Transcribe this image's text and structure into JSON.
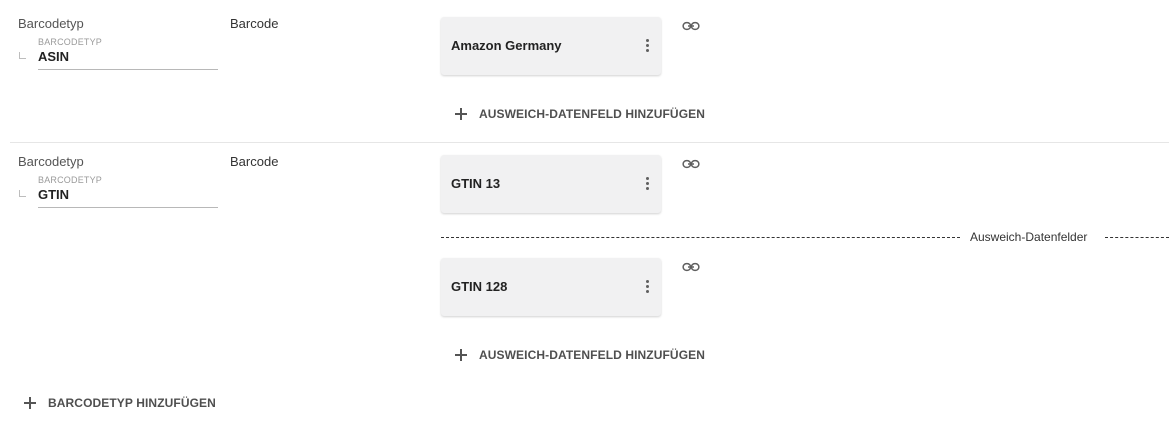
{
  "rows": [
    {
      "type_label": "Barcodetyp",
      "select_label": "BARCODETYP",
      "select_value": "ASIN",
      "field_label": "Barcode",
      "cards": [
        {
          "label": "Amazon Germany"
        }
      ],
      "add_fallback_label": "AUSWEICH-DATENFELD HINZUFÜGEN"
    },
    {
      "type_label": "Barcodetyp",
      "select_label": "BARCODETYP",
      "select_value": "GTIN",
      "field_label": "Barcode",
      "cards": [
        {
          "label": "GTIN 13"
        },
        {
          "label": "GTIN 128"
        }
      ],
      "fallback_divider_label": "Ausweich-Datenfelder",
      "add_fallback_label": "AUSWEICH-DATENFELD HINZUFÜGEN"
    }
  ],
  "add_barcode_type_label": "BARCODETYP HINZUFÜGEN",
  "icons": {
    "link": "link-icon",
    "more": "more-vert-icon",
    "add": "plus-icon",
    "indent": "corner-indent-icon"
  }
}
